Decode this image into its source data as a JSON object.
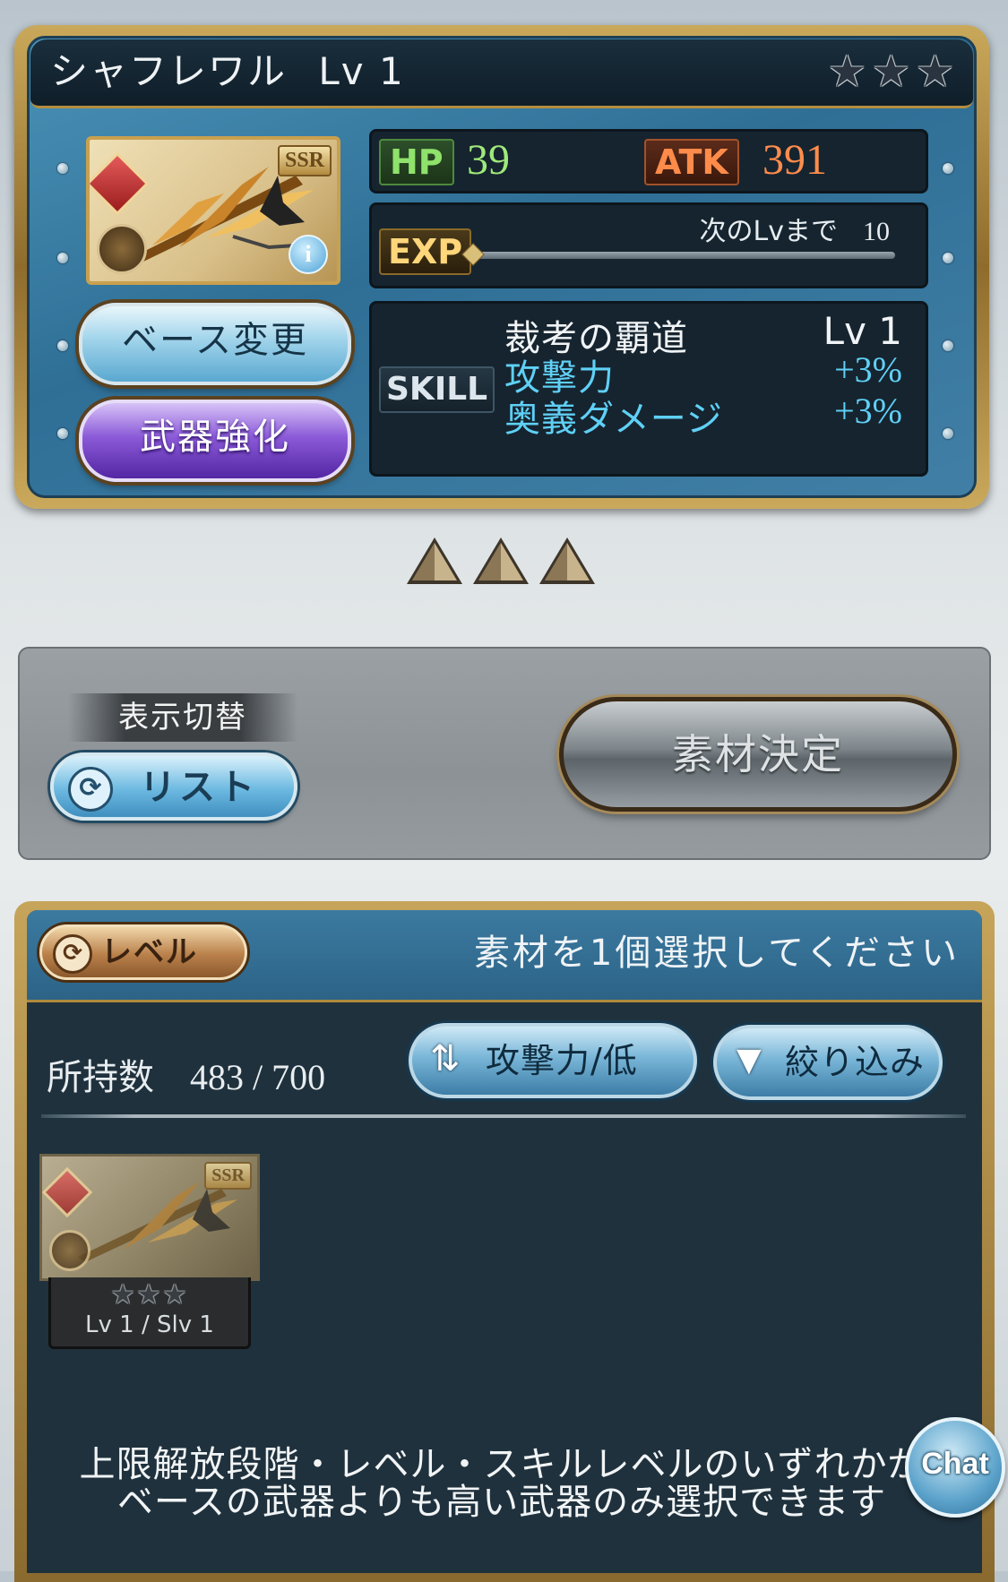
{
  "weapon": {
    "name": "シャフレワル",
    "level_text": "Lv 1",
    "rarity_badge": "SSR",
    "rarity_stars": 3,
    "element_color": "#c93030",
    "info_glyph": "i"
  },
  "stats": {
    "hp_label": "HP",
    "hp_value": "39",
    "atk_label": "ATK",
    "atk_value": "391",
    "exp_label": "EXP",
    "exp_next_label": "次のLvまで",
    "exp_next_value": "10",
    "exp_progress": 0
  },
  "skill": {
    "label": "SKILL",
    "name": "裁考の覇道",
    "level": "Lv 1",
    "effects": [
      {
        "name": "攻撃力",
        "value": "+3%"
      },
      {
        "name": "奥義ダメージ",
        "value": "+3%"
      }
    ]
  },
  "actions": {
    "base_change": "ベース変更",
    "weapon_enhance": "武器強化"
  },
  "uncap": {
    "icon": "uncap-triangle-icon",
    "count": 3
  },
  "controls": {
    "display_toggle_label": "表示切替",
    "list_button": "リスト",
    "decide_button": "素材決定"
  },
  "material_list": {
    "sort_mode_button": "レベル",
    "select_message": "素材を1個選択してください",
    "owned_label": "所持数",
    "owned_count": "483 / 700",
    "sort_button": "攻撃力/低",
    "filter_button": "絞り込み",
    "items": [
      {
        "rarity_badge": "SSR",
        "level_text": "Lv 1 / Slv 1",
        "stars": 3
      }
    ],
    "note_line1": "上限解放段階・レベル・スキルレベルのいずれかが",
    "note_line2": "ベースの武器よりも高い武器のみ選択できます"
  },
  "chat": {
    "label": "Chat"
  },
  "colors": {
    "hp": "#9fe97a",
    "atk": "#ff8c4c",
    "skill_effect": "#5fd0f6",
    "panel_blue": "#2f6f96",
    "frame_gold": "#b48d3e"
  }
}
